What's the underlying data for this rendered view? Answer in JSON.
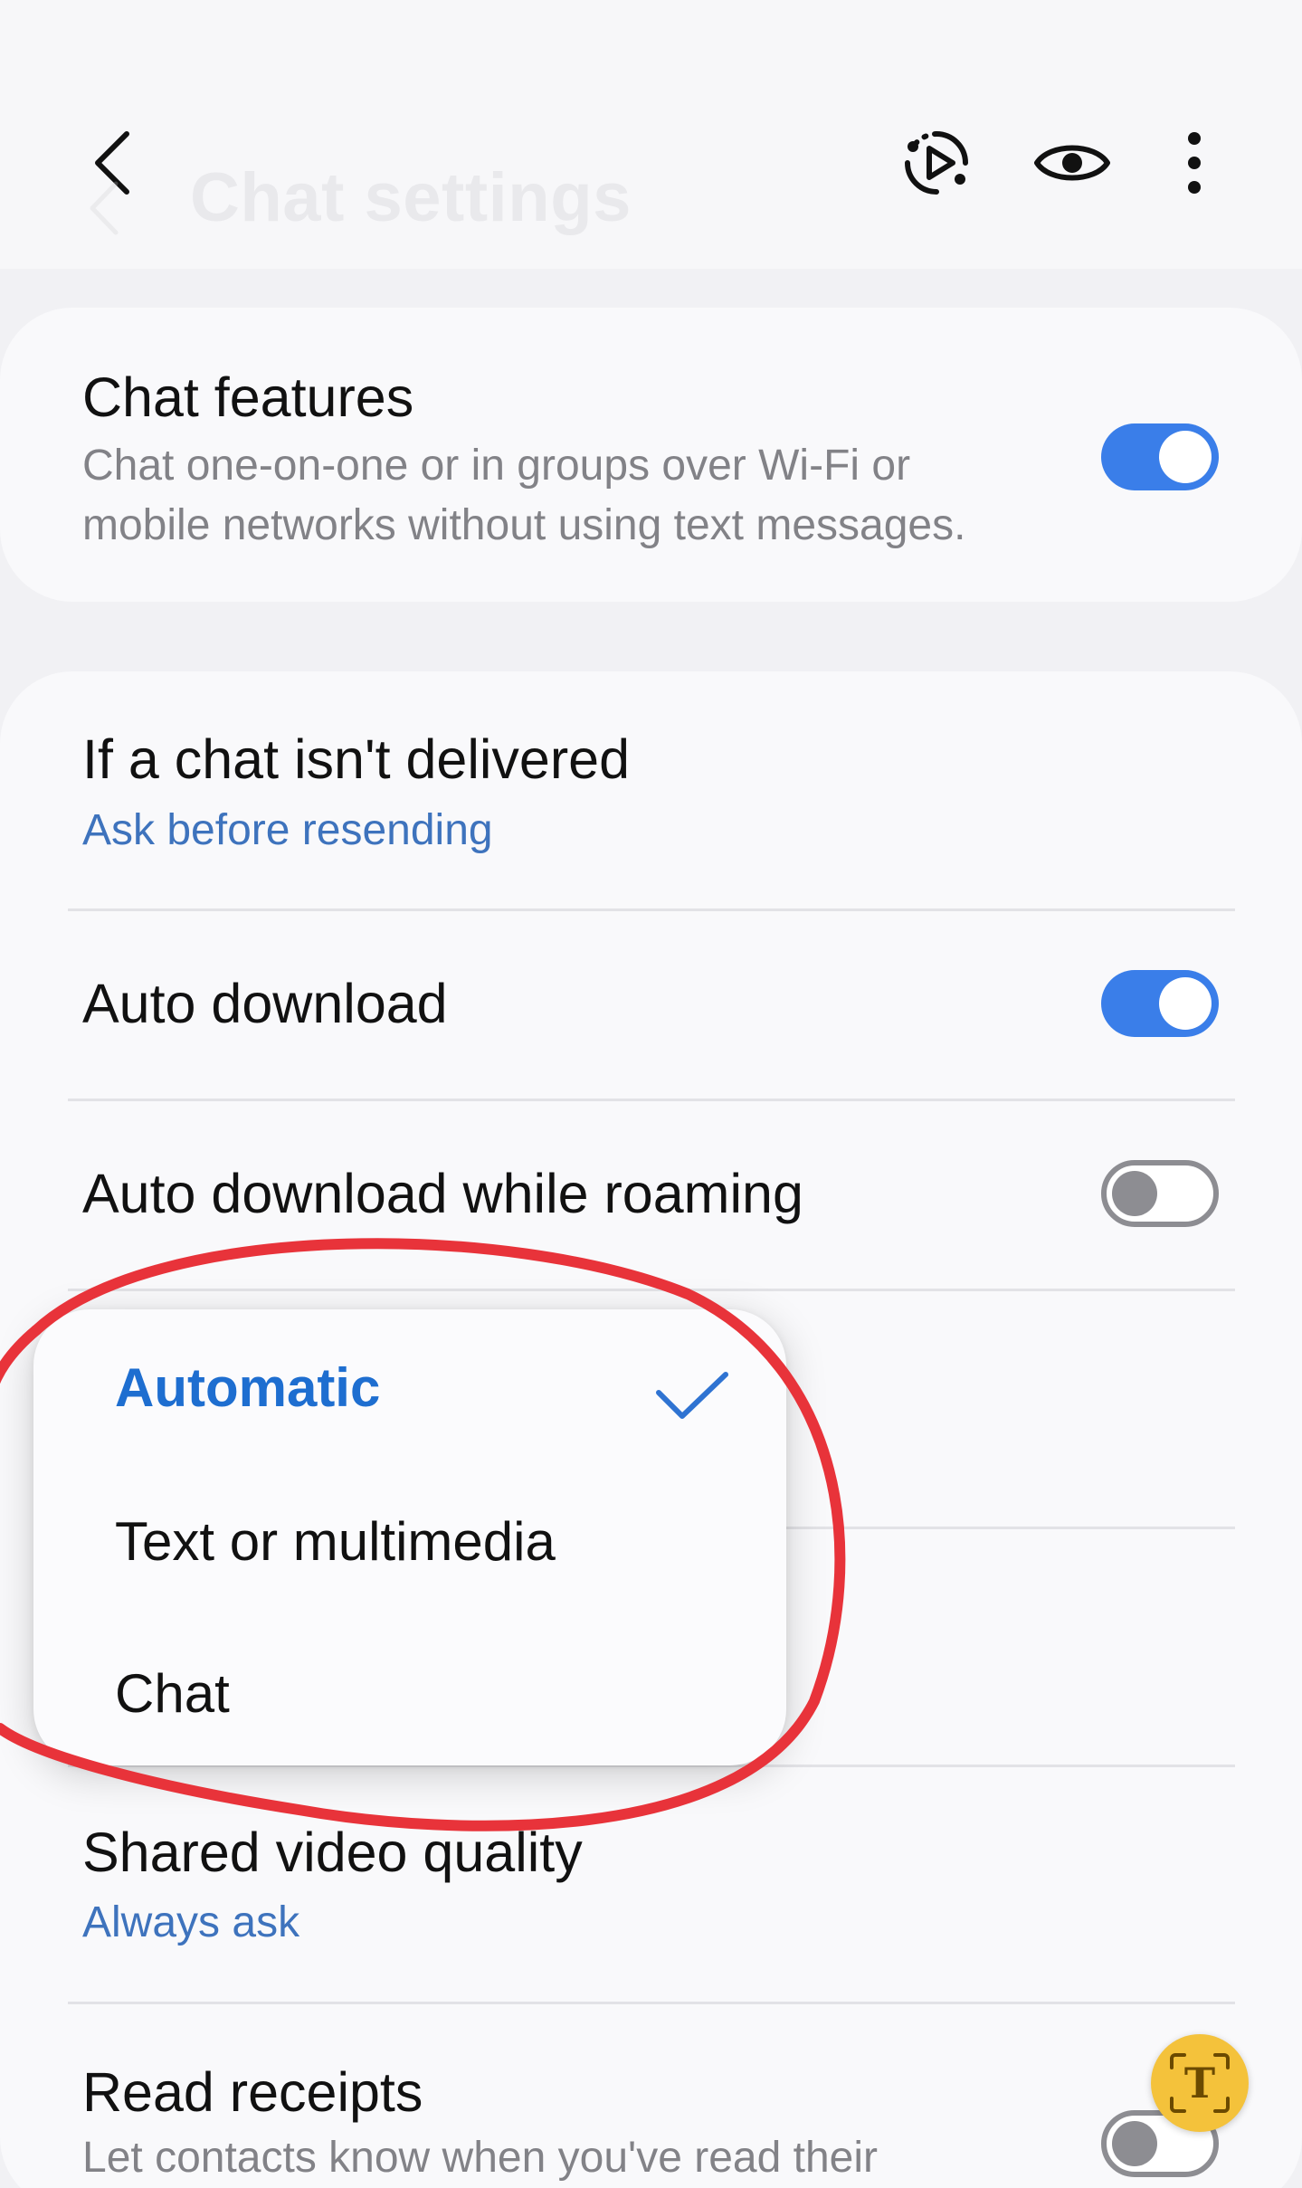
{
  "header": {
    "title": "Chat settings",
    "back_icon": "back-arrow-icon",
    "icons": [
      "screen-recorder-icon",
      "eye-icon",
      "more-options-icon"
    ]
  },
  "chat_features": {
    "title": "Chat features",
    "description": "Chat one-on-one or in groups over Wi-Fi or mobile networks without using text messages.",
    "enabled": true
  },
  "settings": {
    "undelivered": {
      "title": "If a chat isn't delivered",
      "value": "Ask before resending"
    },
    "auto_download": {
      "title": "Auto download",
      "enabled": true
    },
    "auto_download_roaming": {
      "title": "Auto download while roaming",
      "enabled": false
    },
    "shared_video_quality": {
      "title": "Shared video quality",
      "value": "Always ask"
    },
    "read_receipts": {
      "title": "Read receipts",
      "description": "Let contacts know when you've read their",
      "enabled": false
    }
  },
  "dropdown": {
    "options": [
      "Automatic",
      "Text or multimedia",
      "Chat"
    ],
    "selected": "Automatic"
  },
  "colors": {
    "accent": "#3a7ee9",
    "link": "#3e73bd",
    "annotation": "#e8333a",
    "floating_button": "#f4c23b"
  },
  "floating_button": {
    "label": "T"
  }
}
